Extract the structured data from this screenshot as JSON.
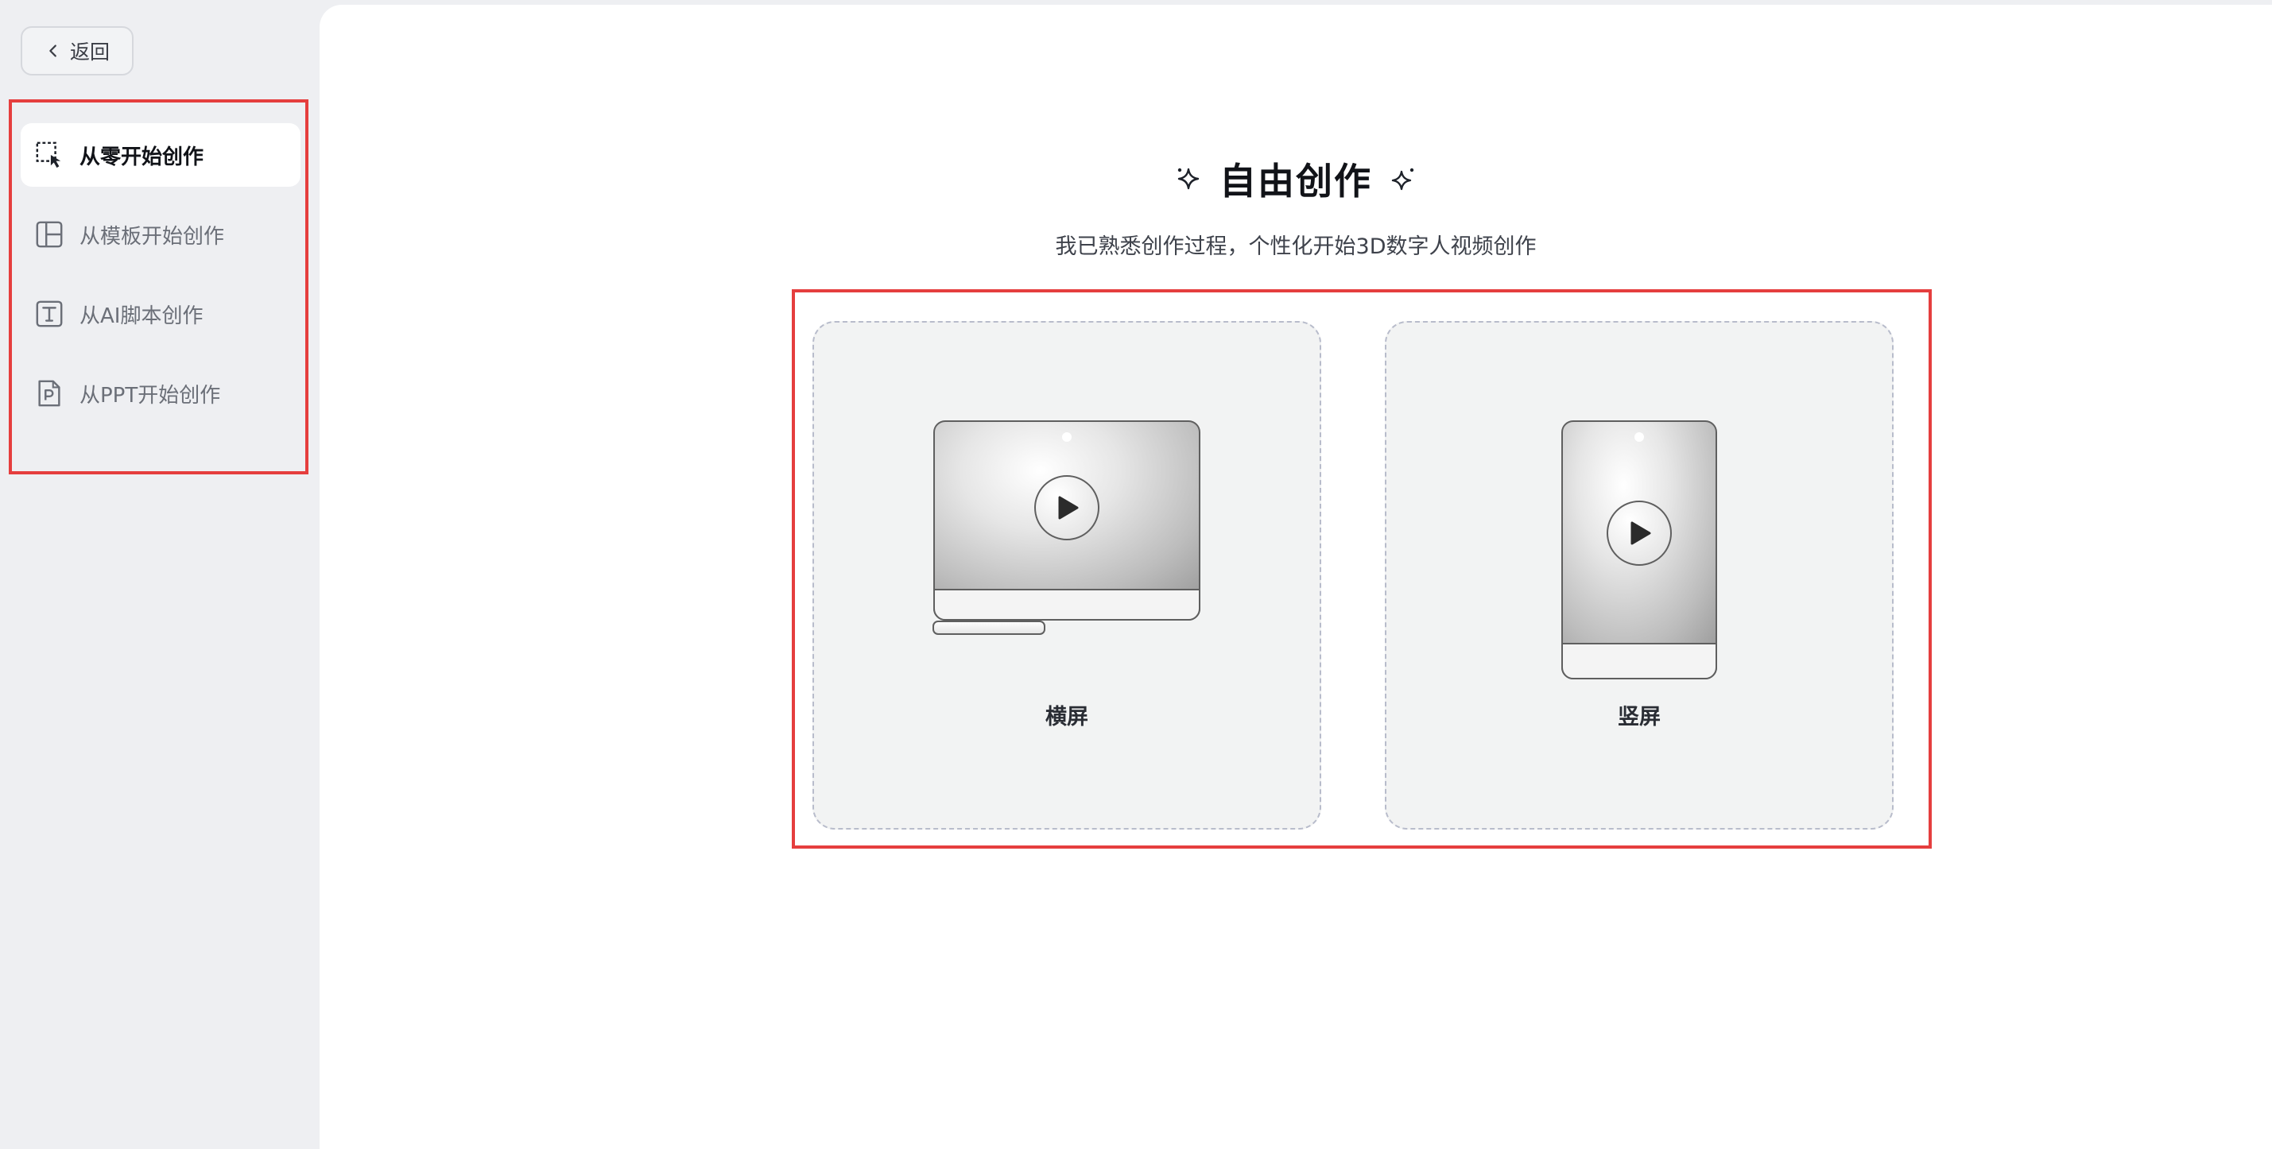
{
  "sidebar": {
    "back_label": "返回",
    "items": [
      {
        "label": "从零开始创作",
        "icon": "select-cursor-icon",
        "active": true
      },
      {
        "label": "从模板开始创作",
        "icon": "template-layout-icon",
        "active": false
      },
      {
        "label": "从AI脚本创作",
        "icon": "text-t-icon",
        "active": false
      },
      {
        "label": "从PPT开始创作",
        "icon": "ppt-file-icon",
        "active": false
      }
    ]
  },
  "main": {
    "title": "自由创作",
    "subtitle": "我已熟悉创作过程，个性化开始3D数字人视频创作",
    "cards": [
      {
        "label": "横屏",
        "icon": "monitor-play-icon"
      },
      {
        "label": "竖屏",
        "icon": "phone-play-icon"
      }
    ]
  },
  "colors": {
    "highlight_border": "#e53e3e",
    "sidebar_bg": "#eeeff2",
    "card_bg": "#f2f3f3"
  }
}
